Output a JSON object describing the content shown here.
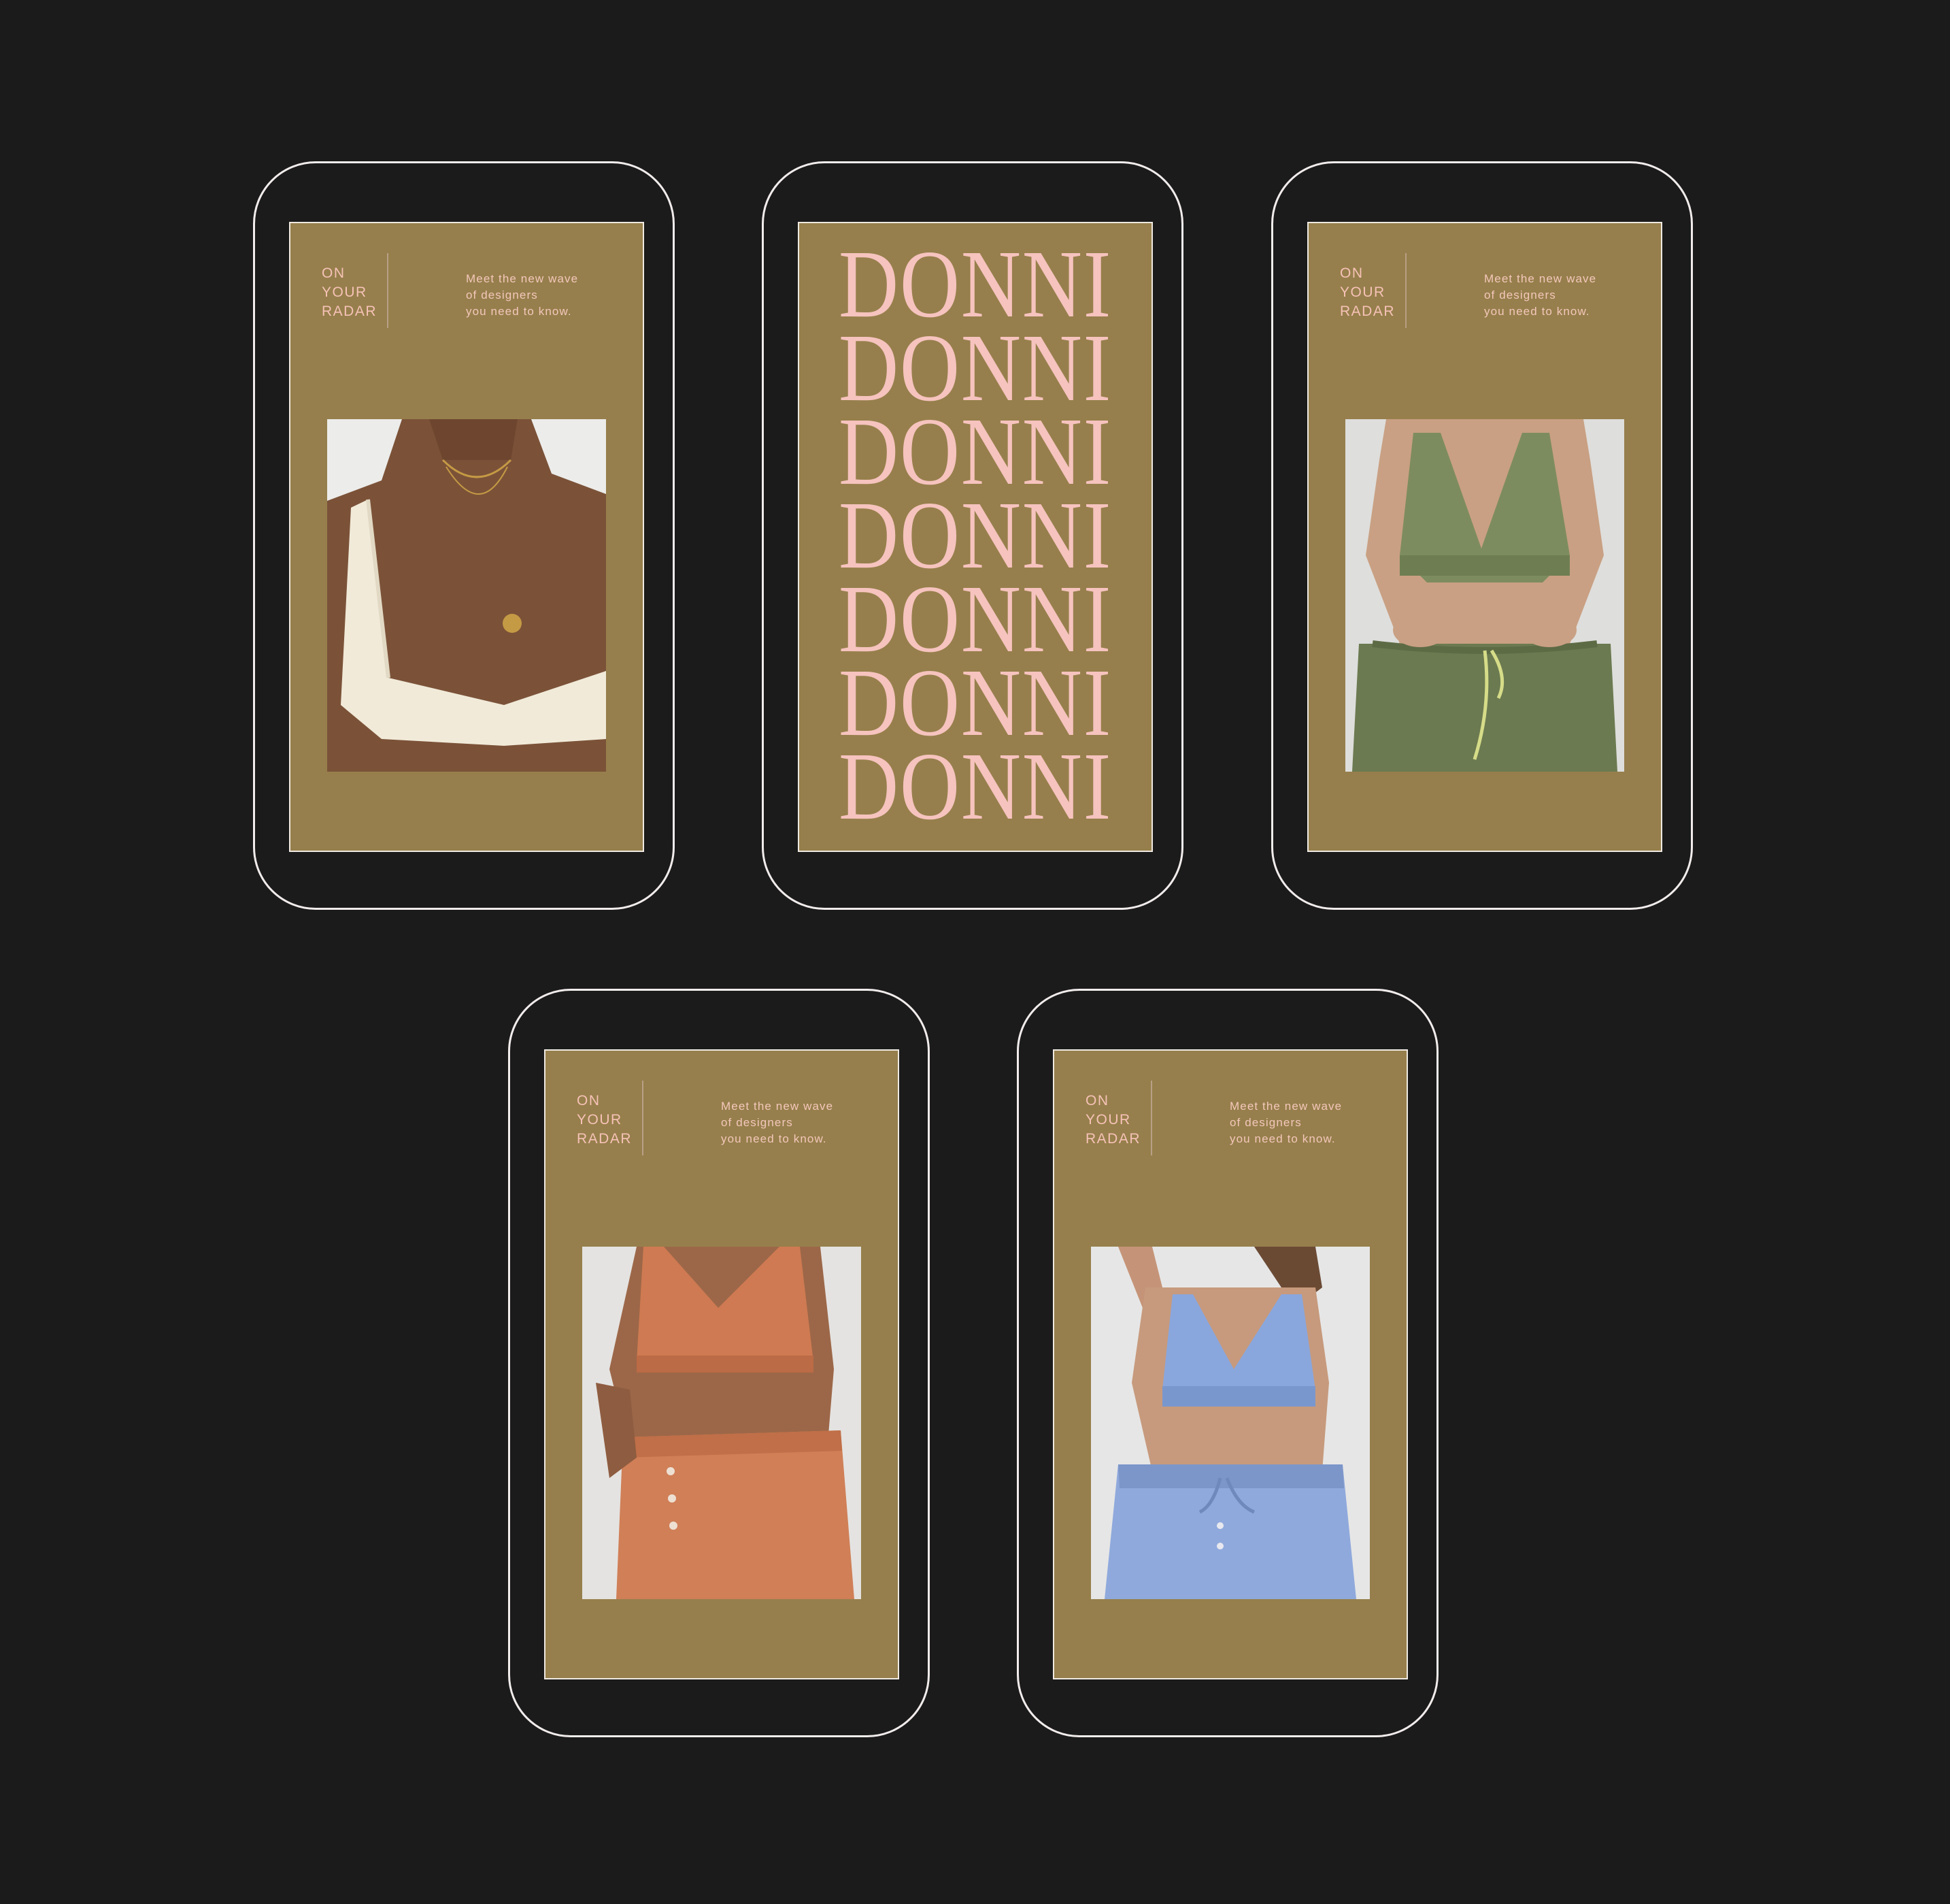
{
  "colors": {
    "background": "#1b1b1b",
    "screen": "#967f4c",
    "accent_pink": "#f6c3be",
    "phone_outline": "#f2ecec"
  },
  "cards": [
    {
      "label_lines": [
        "ON",
        "YOUR",
        "RADAR"
      ],
      "tagline_lines": [
        "Meet the new wave",
        "of designers",
        "you need to know."
      ],
      "photo_subject": "cream-knit-bralette"
    },
    {
      "wordmark_lines": [
        "DONNI",
        "DONNI",
        "DONNI",
        "DONNI",
        "DONNI",
        "DONNI",
        "DONNI"
      ]
    },
    {
      "label_lines": [
        "ON",
        "YOUR",
        "RADAR"
      ],
      "tagline_lines": [
        "Meet the new wave",
        "of designers",
        "you need to know."
      ],
      "photo_subject": "olive-bralette-and-sweatpants"
    },
    {
      "label_lines": [
        "ON",
        "YOUR",
        "RADAR"
      ],
      "tagline_lines": [
        "Meet the new wave",
        "of designers",
        "you need to know."
      ],
      "photo_subject": "terracotta-bralette-and-sweatpants"
    },
    {
      "label_lines": [
        "ON",
        "YOUR",
        "RADAR"
      ],
      "tagline_lines": [
        "Meet the new wave",
        "of designers",
        "you need to know."
      ],
      "photo_subject": "blue-terry-bralette-and-sweatpants"
    }
  ]
}
